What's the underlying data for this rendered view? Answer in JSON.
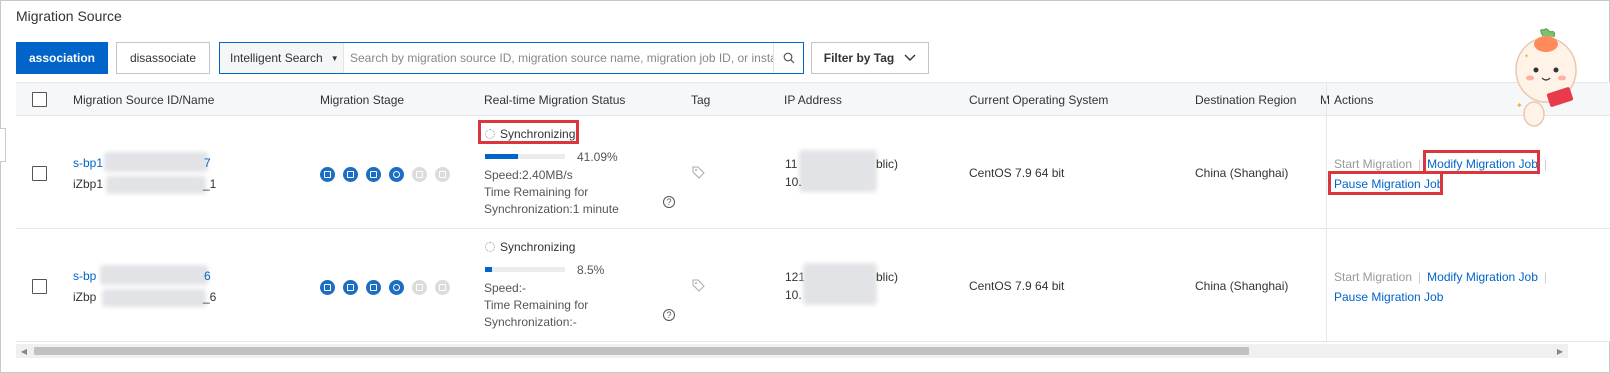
{
  "page": {
    "title": "Migration Source"
  },
  "toolbar": {
    "association_label": "association",
    "disassociate_label": "disassociate",
    "search_mode": "Intelligent Search",
    "search_placeholder": "Search by migration source ID, migration source name, migration job ID, or insta",
    "filter_label": "Filter by Tag"
  },
  "table": {
    "headers": {
      "source": "Migration Source ID/Name",
      "stage": "Migration Stage",
      "status": "Real-time Migration Status",
      "tag": "Tag",
      "ip": "IP Address",
      "os": "Current Operating System",
      "region": "Destination Region",
      "m": "M",
      "actions": "Actions"
    },
    "rows": [
      {
        "id_prefix": "s-bp1",
        "id_suffix": "7",
        "name_prefix": "iZbp1",
        "name_suffix": "_1",
        "status": "Synchronizing",
        "progress": 41.09,
        "progress_label": "41.09%",
        "speed": "Speed:2.40MB/s",
        "time_remaining_1": "Time Remaining for",
        "time_remaining_2": "Synchronization:1 minute",
        "ip_line1_prefix": "11",
        "ip_line1_suffix": "blic)",
        "ip_line2_prefix": "10.",
        "os": "CentOS 7.9 64 bit",
        "region": "China (Shanghai)",
        "action_start": "Start Migration",
        "action_modify": "Modify Migration Job",
        "action_pause": "Pause Migration Job",
        "highlighted": true
      },
      {
        "id_prefix": "s-bp",
        "id_suffix": "6",
        "name_prefix": "iZbp",
        "name_suffix": "_6",
        "status": "Synchronizing",
        "progress": 8.5,
        "progress_label": "8.5%",
        "speed": "Speed:-",
        "time_remaining_1": "Time Remaining for",
        "time_remaining_2": "Synchronization:-",
        "ip_line1_prefix": "121",
        "ip_line1_suffix": "blic)",
        "ip_line2_prefix": "10.",
        "os": "CentOS 7.9 64 bit",
        "region": "China (Shanghai)",
        "action_start": "Start Migration",
        "action_modify": "Modify Migration Job",
        "action_pause": "Pause Migration Job",
        "highlighted": false
      }
    ]
  },
  "icons": {
    "search": "search-icon",
    "caret": "caret-down-icon",
    "chevron": "chevron-down-icon",
    "tag": "tag-icon",
    "help": "help-icon",
    "spinner": "loading-icon",
    "mascot": "mascot-sticker"
  },
  "colors": {
    "primary": "#0064c8",
    "highlight": "#d9363e",
    "progress": "#0064c8"
  }
}
